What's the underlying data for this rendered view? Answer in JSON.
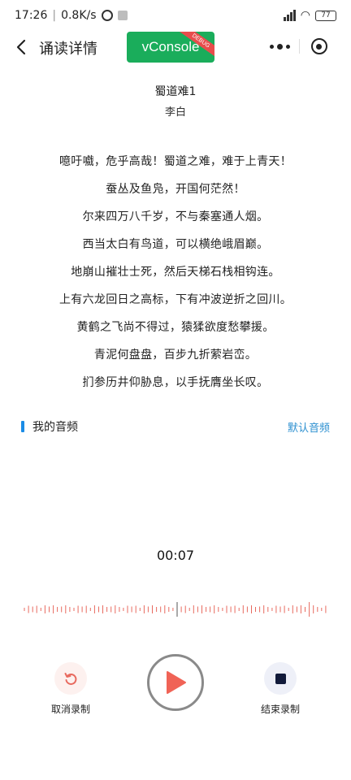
{
  "status": {
    "time": "17:26",
    "speed": "0.8K/s",
    "battery": "77"
  },
  "nav": {
    "title": "诵读详情",
    "vconsole_label": "vConsole",
    "vconsole_ribbon": "DEBUG"
  },
  "poem": {
    "title": "蜀道难1",
    "author": "李白",
    "lines": [
      "噫吁嚱，危乎高哉！蜀道之难，难于上青天！",
      "蚕丛及鱼凫，开国何茫然！",
      "尔来四万八千岁，不与秦塞通人烟。",
      "西当太白有鸟道，可以横绝峨眉巅。",
      "地崩山摧壮士死，然后天梯石栈相钩连。",
      "上有六龙回日之高标，下有冲波逆折之回川。",
      "黄鹤之飞尚不得过，猿猱欲度愁攀援。",
      "青泥何盘盘，百步九折萦岩峦。",
      "扪参历井仰胁息，以手抚膺坐长叹。"
    ]
  },
  "audio_section": {
    "title": "我的音频",
    "default_label": "默认音频",
    "accent_color": "#1a8ce6",
    "link_color": "#2b8fd0"
  },
  "recorder": {
    "timer": "00:07",
    "cancel_label": "取消录制",
    "stop_label": "结束录制",
    "wave_color": "#e86a5f",
    "play_color": "#f06356"
  }
}
